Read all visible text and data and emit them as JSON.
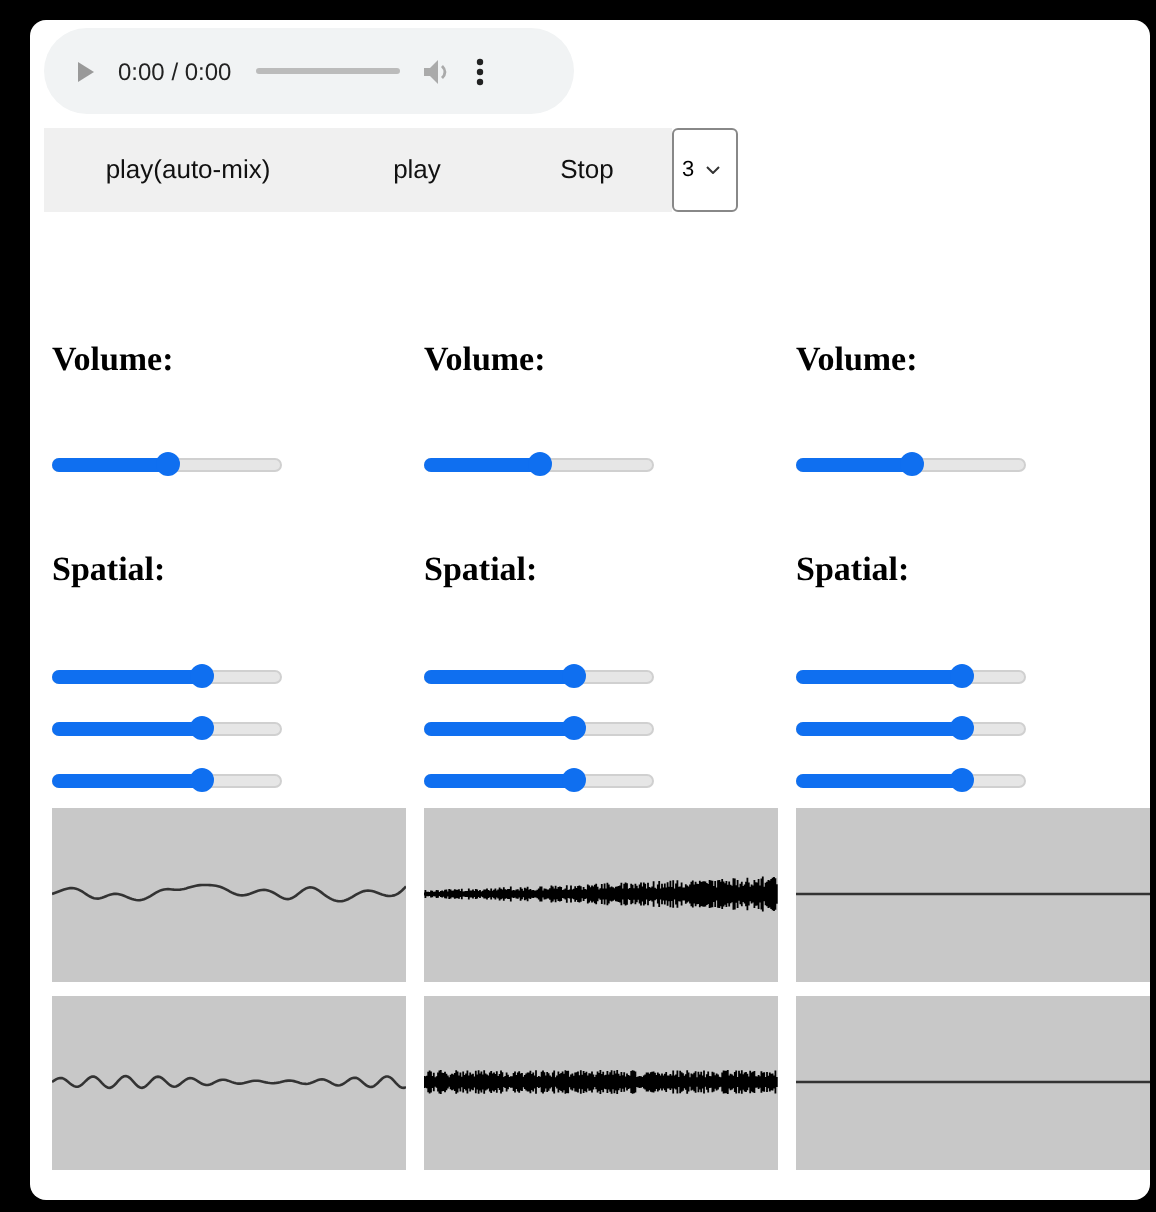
{
  "audio_player": {
    "time": "0:00 / 0:00"
  },
  "buttons": [
    {
      "label": "play(auto-mix)"
    },
    {
      "label": "play"
    },
    {
      "label": "Stop"
    }
  ],
  "select": {
    "value": "3"
  },
  "tracks": [
    {
      "volume": {
        "label": "Volume:",
        "level": 0.5
      },
      "spatial": {
        "label": "Spatial:",
        "levels": [
          {
            "level": 0.65
          },
          {
            "level": 0.65
          },
          {
            "level": 0.65
          }
        ]
      },
      "waveforms": [
        {
          "kind": "tonal"
        },
        {
          "kind": "tonal"
        }
      ]
    },
    {
      "volume": {
        "label": "Volume:",
        "level": 0.5
      },
      "spatial": {
        "label": "Spatial:",
        "levels": [
          {
            "level": 0.65
          },
          {
            "level": 0.65
          },
          {
            "level": 0.65
          }
        ]
      },
      "waveforms": [
        {
          "kind": "noise"
        },
        {
          "kind": "noise"
        }
      ]
    },
    {
      "volume": {
        "label": "Volume:",
        "level": 0.5
      },
      "spatial": {
        "label": "Spatial:",
        "levels": [
          {
            "level": 0.72
          },
          {
            "level": 0.72
          },
          {
            "level": 0.72
          }
        ]
      },
      "waveforms": [
        {
          "kind": "flat"
        },
        {
          "kind": "flat"
        }
      ]
    }
  ]
}
